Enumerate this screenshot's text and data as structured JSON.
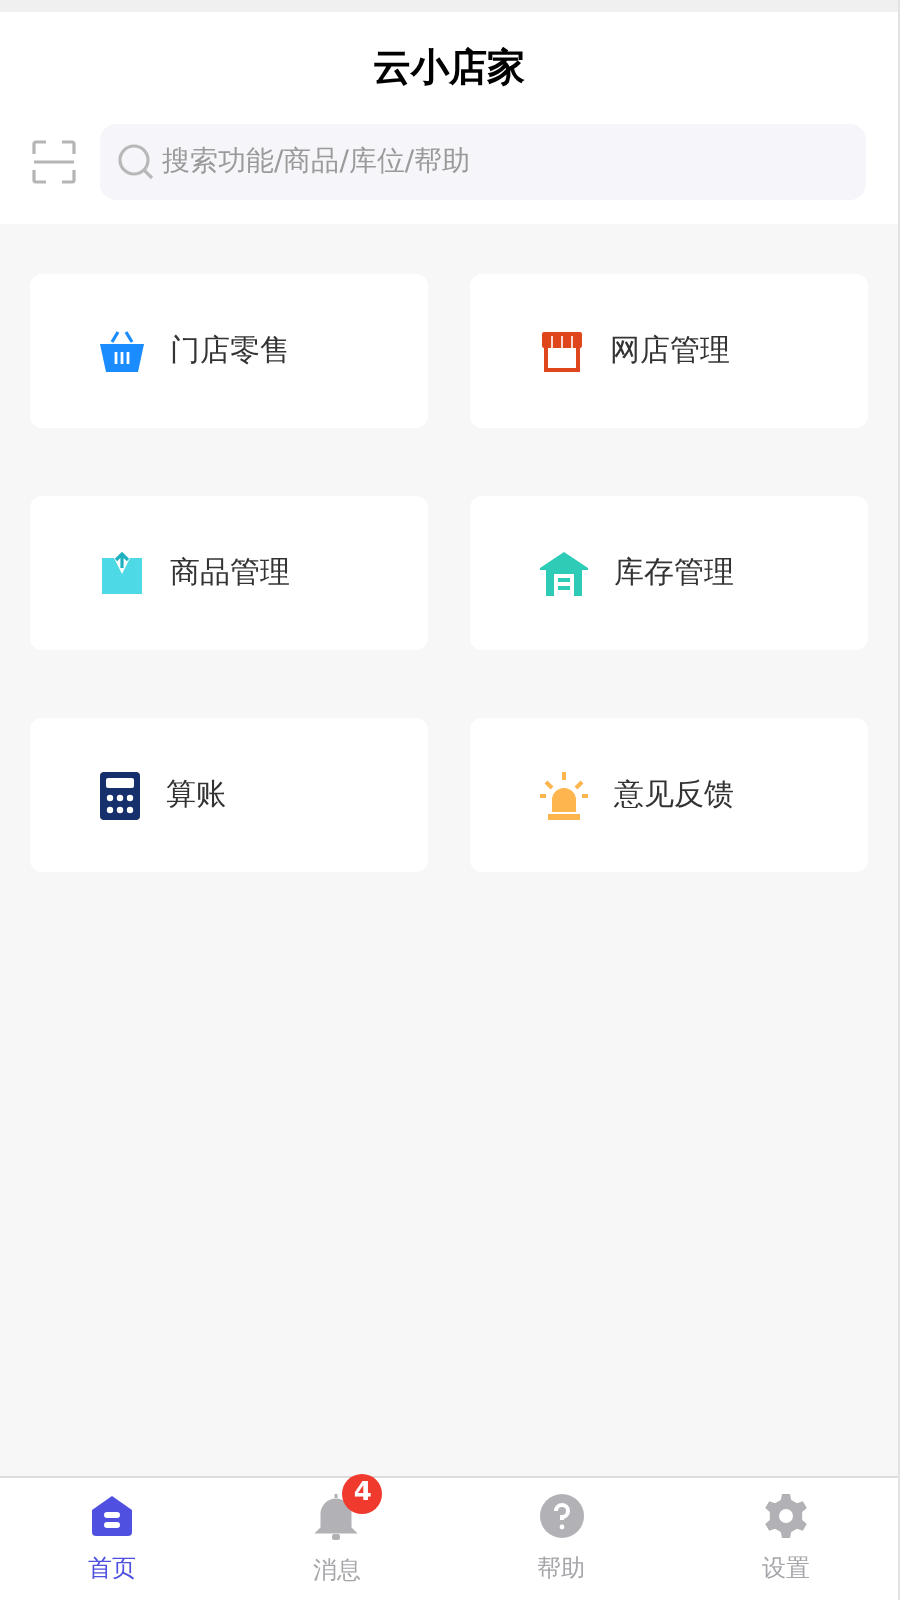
{
  "header": {
    "title": "云小店家",
    "search": {
      "placeholder": "搜索功能/商品/库位/帮助"
    }
  },
  "tiles": [
    {
      "kind": "basket",
      "label": "门店零售"
    },
    {
      "kind": "store",
      "label": "网店管理"
    },
    {
      "kind": "inbox",
      "label": "商品管理"
    },
    {
      "kind": "warehouse",
      "label": "库存管理"
    },
    {
      "kind": "calculator",
      "label": "算账"
    },
    {
      "kind": "alarm",
      "label": "意见反馈"
    }
  ],
  "tabbar": [
    {
      "kind": "home",
      "label": "首页",
      "selected": true
    },
    {
      "kind": "bell",
      "label": "消息",
      "selected": false,
      "badge": "4"
    },
    {
      "kind": "help",
      "label": "帮助",
      "selected": false
    },
    {
      "kind": "settings",
      "label": "设置",
      "selected": false
    }
  ]
}
